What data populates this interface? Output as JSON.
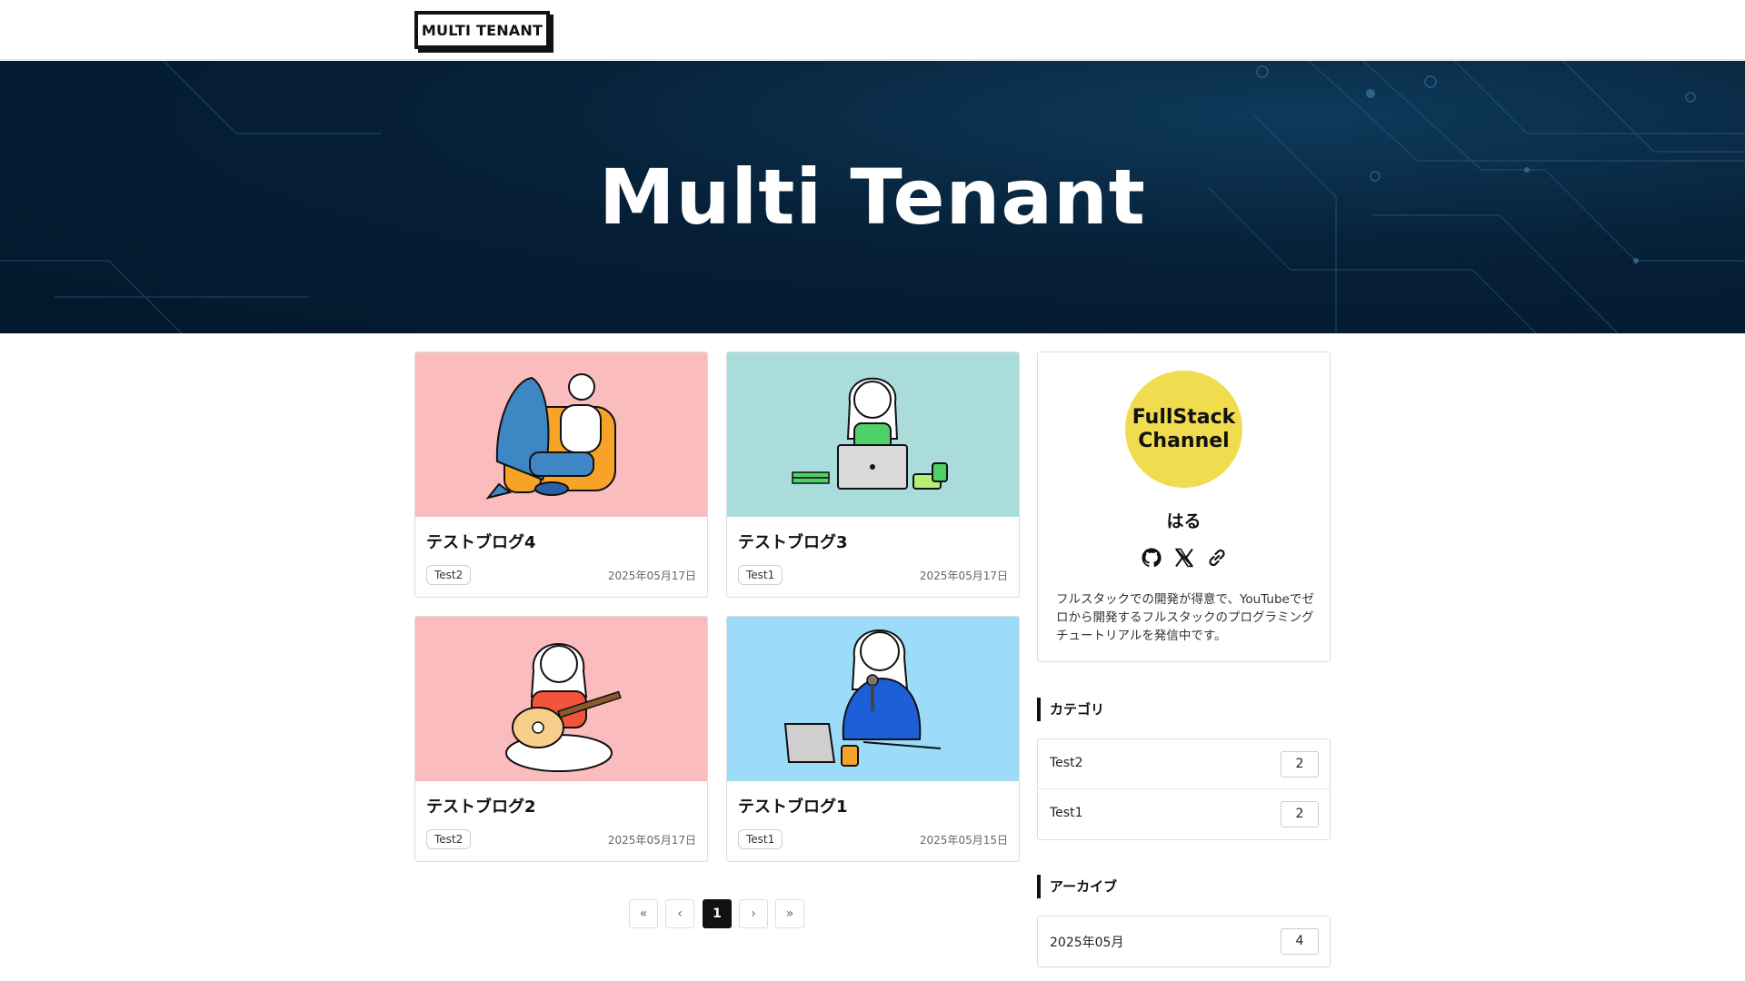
{
  "header": {
    "logo": "MULTI TENANT"
  },
  "hero": {
    "title": "Multi Tenant"
  },
  "posts": [
    {
      "title": "テストブログ4",
      "tag": "Test2",
      "date": "2025年05月17日",
      "image_bg": "#fbbcbe",
      "illustration": "shark-on-sofa-illustration"
    },
    {
      "title": "テストブログ3",
      "tag": "Test1",
      "date": "2025年05月17日",
      "image_bg": "#aadcdc",
      "illustration": "laptop-girl-illustration"
    },
    {
      "title": "テストブログ2",
      "tag": "Test2",
      "date": "2025年05月17日",
      "image_bg": "#fbbcbe",
      "illustration": "guitar-girl-illustration"
    },
    {
      "title": "テストブログ1",
      "tag": "Test1",
      "date": "2025年05月15日",
      "image_bg": "#9ddcf9",
      "illustration": "microphone-girl-illustration"
    }
  ],
  "pagination": {
    "first": "«",
    "prev": "‹",
    "current": "1",
    "next": "›",
    "last": "»"
  },
  "profile": {
    "avatar_line1": "FullStack",
    "avatar_line2": "Channel",
    "name": "はる",
    "description": "フルスタックでの開発が得意で、YouTubeでゼロから開発するフルスタックのプログラミングチュートリアルを発信中です。",
    "social_icons": [
      "github-icon",
      "x-icon",
      "link-icon"
    ]
  },
  "categories": {
    "title": "カテゴリ",
    "items": [
      {
        "label": "Test2",
        "count": "2"
      },
      {
        "label": "Test1",
        "count": "2"
      }
    ]
  },
  "archive": {
    "title": "アーカイブ",
    "items": [
      {
        "label": "2025年05月",
        "count": "4"
      }
    ]
  },
  "colors": {
    "hero_dark": "#03172b",
    "avatar_yellow": "#f0dc4e",
    "accent_dark": "#111111"
  }
}
